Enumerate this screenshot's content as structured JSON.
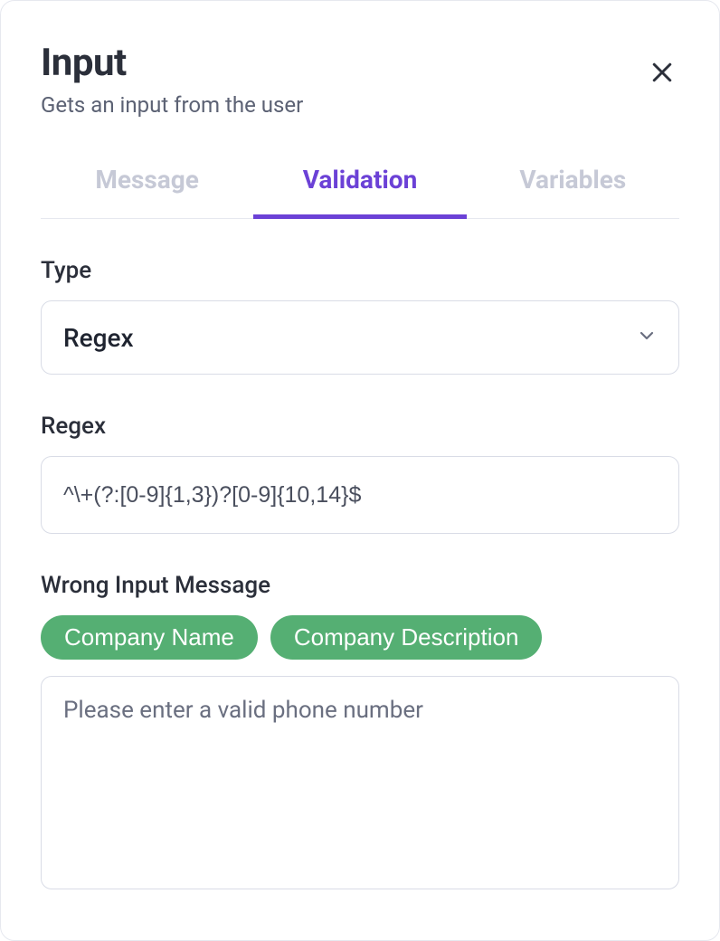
{
  "header": {
    "title": "Input",
    "subtitle": "Gets an input from the user"
  },
  "tabs": [
    {
      "label": "Message",
      "active": false
    },
    {
      "label": "Validation",
      "active": true
    },
    {
      "label": "Variables",
      "active": false
    }
  ],
  "type_field": {
    "label": "Type",
    "value": "Regex"
  },
  "regex_field": {
    "label": "Regex",
    "value": "^\\+(?:[0-9]{1,3})?[0-9]{10,14}$"
  },
  "wrong_input": {
    "label": "Wrong Input Message",
    "chips": [
      "Company Name",
      "Company Description"
    ],
    "placeholder": "Please enter a valid phone number",
    "value": ""
  }
}
